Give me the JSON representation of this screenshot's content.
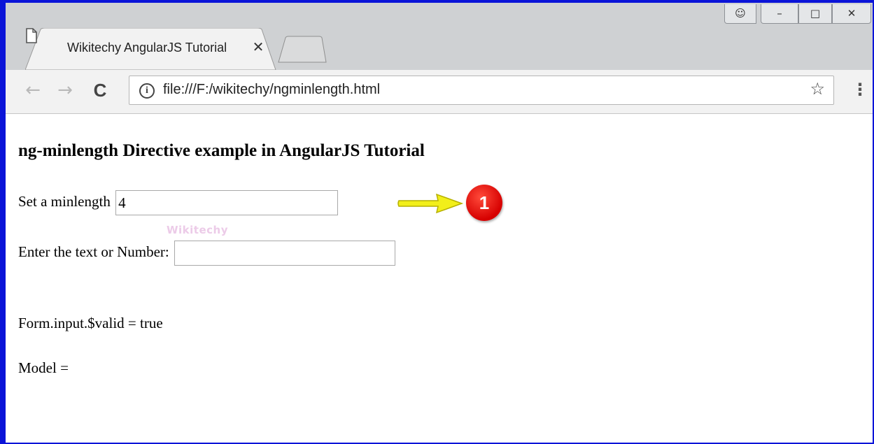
{
  "browser": {
    "tab_title": "Wikitechy AngularJS Tutorial",
    "tab_close": "✕",
    "url": "file:///F:/wikitechy/ngminlength.html",
    "nav": {
      "back": "←",
      "forward": "→",
      "reload": "C"
    },
    "bookmark_icon": "☆",
    "menu_icon": "⋮",
    "info_icon": "i",
    "window_controls": {
      "user": "☺",
      "minimize": "–",
      "restore": "□",
      "close": "✕"
    }
  },
  "page": {
    "heading": "ng-minlength Directive example in AngularJS Tutorial",
    "minlength_label": "Set a minlength",
    "minlength_value": "4",
    "text_label": "Enter the text or Number:",
    "text_value": "",
    "valid_line": "Form.input.$valid = true",
    "model_line": "Model =",
    "watermark": "Wikitechy"
  },
  "annotation": {
    "badge_number": "1"
  },
  "colors": {
    "frame_border": "#0b14d8",
    "badge": "#d60000",
    "arrow": "#f2ef1a"
  }
}
